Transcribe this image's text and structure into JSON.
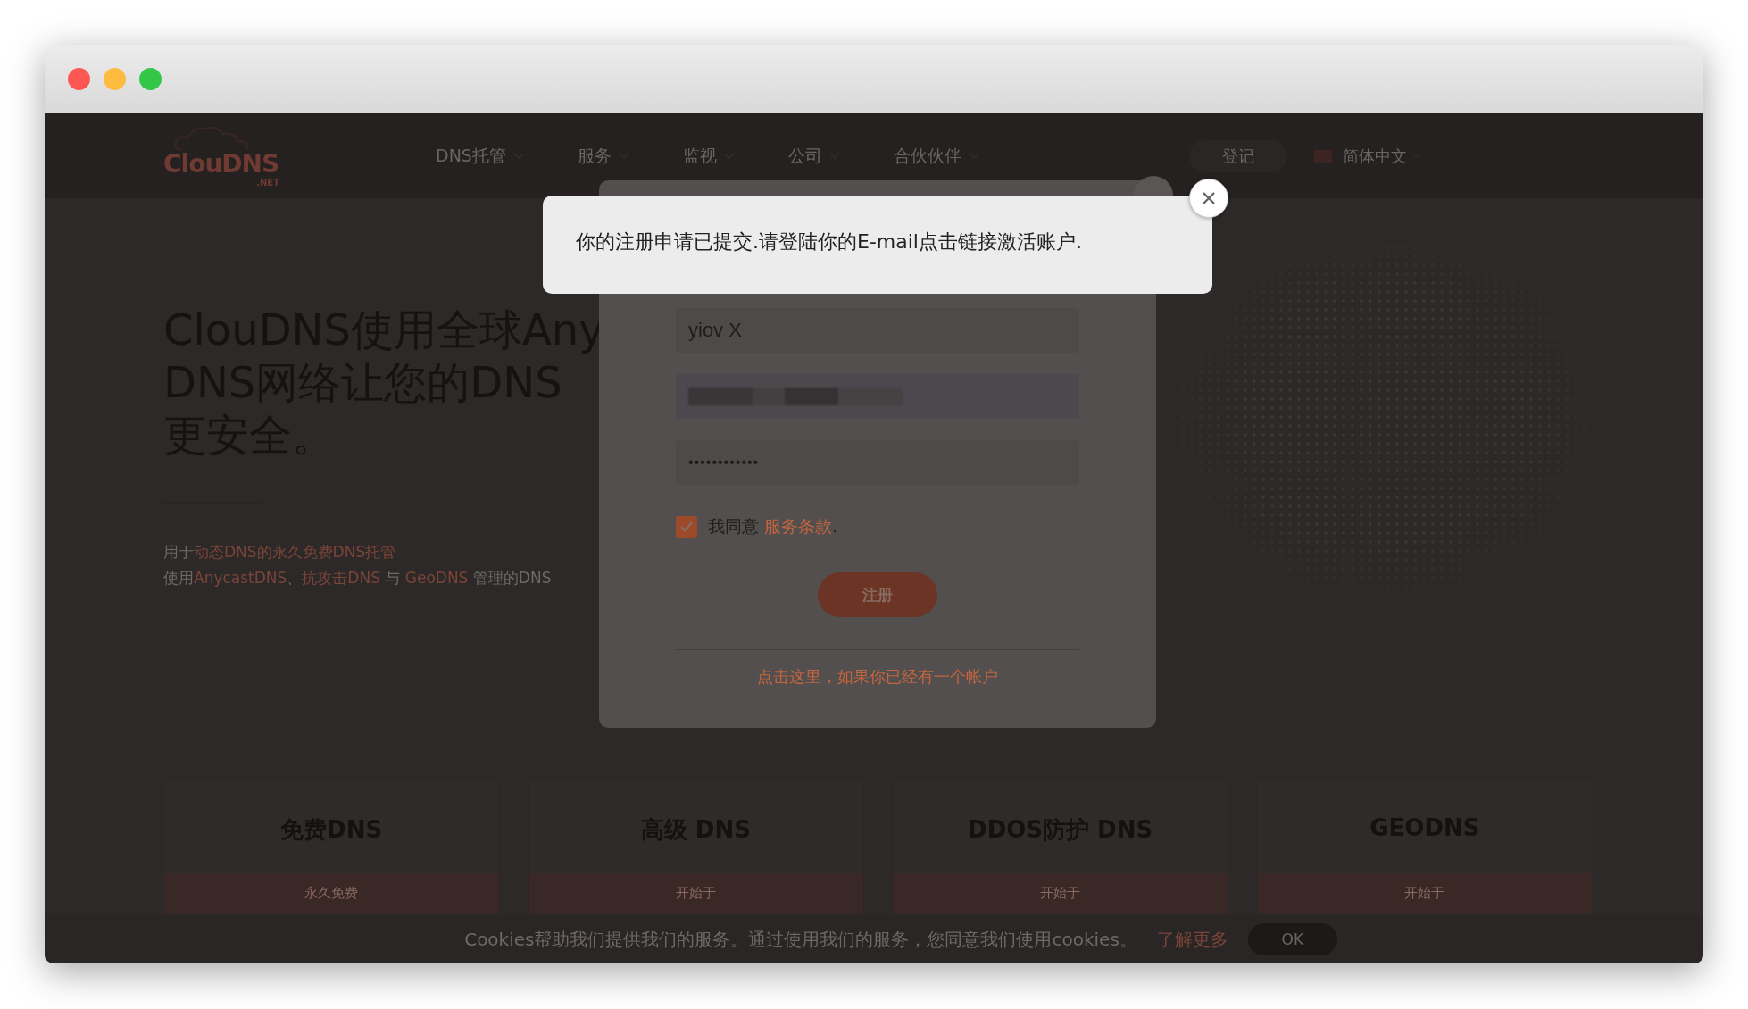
{
  "nav": {
    "logo": "ClouDNS",
    "logo_suffix": ".NET",
    "items": [
      {
        "label": "DNS托管"
      },
      {
        "label": "服务"
      },
      {
        "label": "监视"
      },
      {
        "label": "公司"
      },
      {
        "label": "合伙伙伴"
      }
    ],
    "login": "登记",
    "language": "简体中文"
  },
  "hero": {
    "title_lines": [
      "ClouDNS使用全球Any",
      "DNS网络让您的DNS",
      "更安全。"
    ],
    "subtitle_lines": [
      [
        {
          "kind": "text",
          "text": "用于"
        },
        {
          "kind": "link",
          "text": "动态DNS的永久免费DNS托管"
        }
      ],
      [
        {
          "kind": "text",
          "text": "使用"
        },
        {
          "kind": "link",
          "text": "AnycastDNS"
        },
        {
          "kind": "text",
          "text": "、"
        },
        {
          "kind": "link",
          "text": "抗攻击DNS"
        },
        {
          "kind": "text",
          "text": " 与 "
        },
        {
          "kind": "link",
          "text": "GeoDNS"
        },
        {
          "kind": "text",
          "text": " 管理的DNS"
        }
      ]
    ]
  },
  "cards": [
    {
      "title": "免费DNS",
      "button": "永久免费"
    },
    {
      "title": "高级 DNS",
      "button": "开始于"
    },
    {
      "title": "DDOS防护 DNS",
      "button": "开始于"
    },
    {
      "title": "GEODNS",
      "button": "开始于"
    }
  ],
  "signup": {
    "fields": [
      {
        "kind": "text",
        "value": "yiov X"
      },
      {
        "kind": "redacted"
      },
      {
        "kind": "password",
        "value": "••••••••••••"
      }
    ],
    "agree": {
      "checked": true,
      "label": "我同意",
      "link": "服务条款",
      "end": "."
    },
    "submit": "注册",
    "login_link": "点击这里，如果你已经有一个帐户"
  },
  "alert": {
    "message": "你的注册申请已提交.请登陆你的E-mail点击链接激活账户."
  },
  "cookie_bar": {
    "text": "Cookies帮助我们提供我们的服务。通过使用我们的服务，您同意我们使用cookies。",
    "link": "了解更多",
    "button": "OK"
  }
}
